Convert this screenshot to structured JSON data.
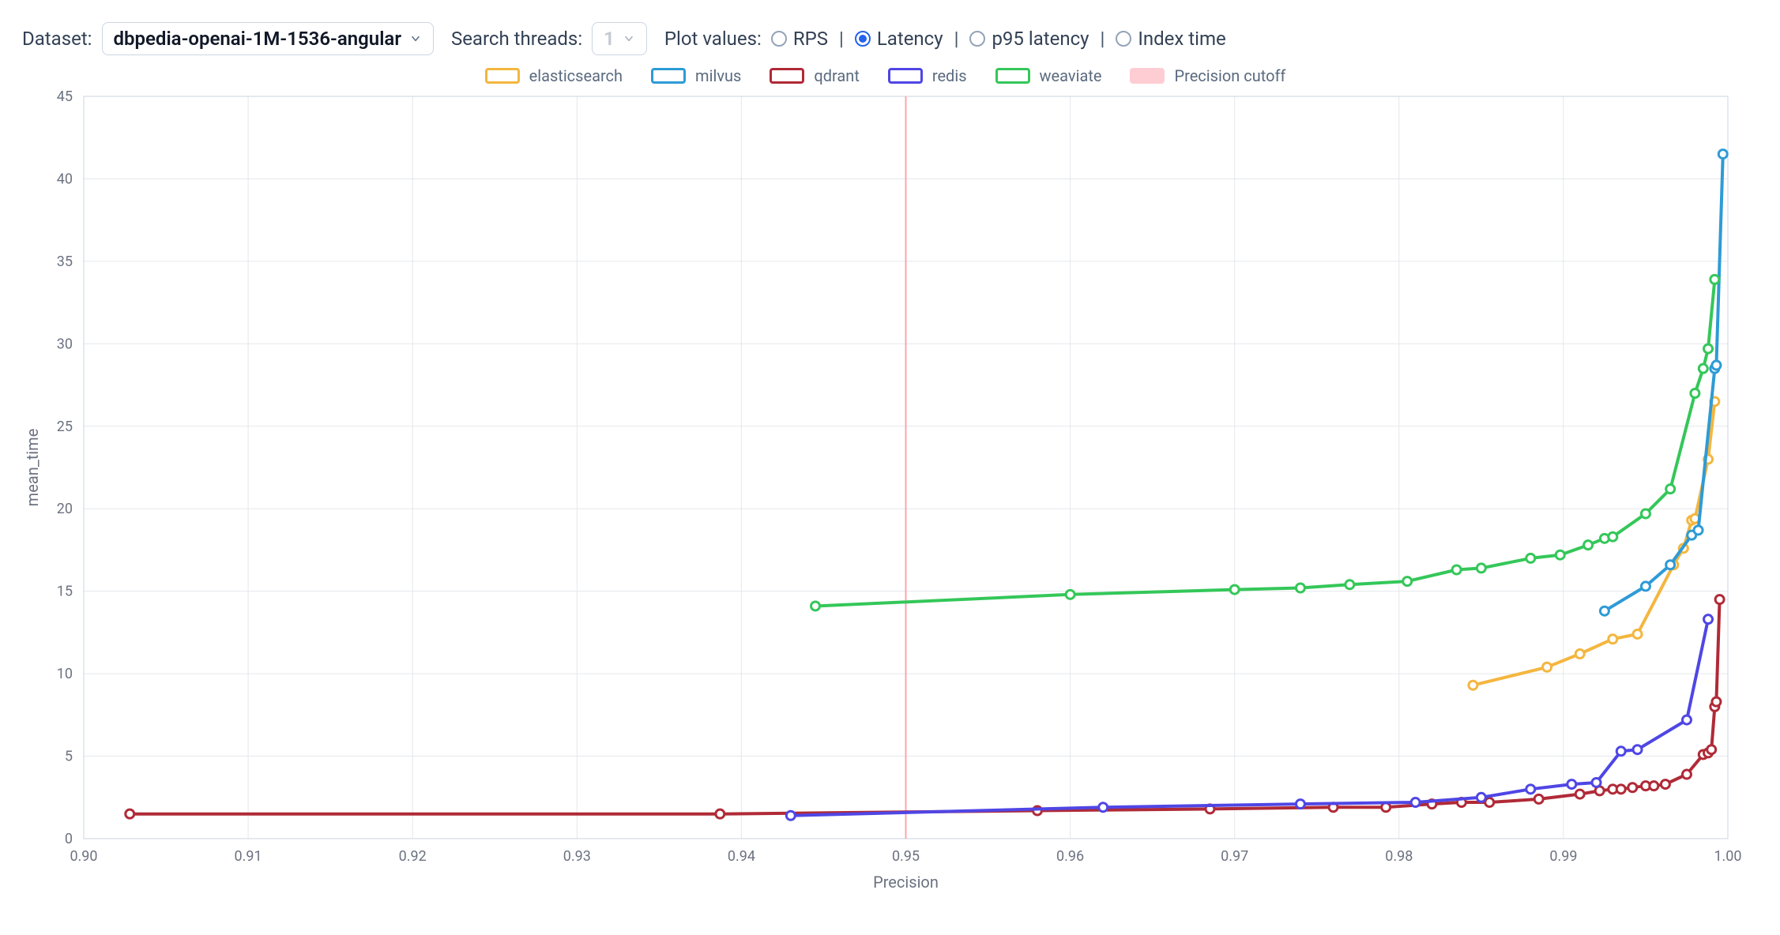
{
  "controls": {
    "dataset_label": "Dataset:",
    "dataset_value": "dbpedia-openai-1M-1536-angular",
    "threads_label": "Search threads:",
    "threads_value": "1",
    "plot_values_label": "Plot values:",
    "options": {
      "rps": "RPS",
      "latency": "Latency",
      "p95": "p95 latency",
      "index": "Index time"
    },
    "selected": "latency"
  },
  "legend": [
    {
      "key": "elasticsearch",
      "label": "elasticsearch",
      "color": "#f4b63f"
    },
    {
      "key": "milvus",
      "label": "milvus",
      "color": "#2e9bd6"
    },
    {
      "key": "qdrant",
      "label": "qdrant",
      "color": "#b02a37"
    },
    {
      "key": "redis",
      "label": "redis",
      "color": "#4f46e5"
    },
    {
      "key": "weaviate",
      "label": "weaviate",
      "color": "#34c759"
    },
    {
      "key": "cutoff",
      "label": "Precision cutoff",
      "color": "#fecdd3",
      "type": "area"
    }
  ],
  "chart_data": {
    "type": "line",
    "title": "",
    "xlabel": "Precision",
    "ylabel": "mean_time",
    "xlim": [
      0.9,
      1.0
    ],
    "ylim": [
      0,
      45
    ],
    "xticks": [
      0.9,
      0.91,
      0.92,
      0.93,
      0.94,
      0.95,
      0.96,
      0.97,
      0.98,
      0.99,
      1.0
    ],
    "yticks": [
      0,
      5,
      10,
      15,
      20,
      25,
      30,
      35,
      40,
      45
    ],
    "precision_cutoff": 0.95,
    "series": [
      {
        "name": "elasticsearch",
        "color": "#f4b63f",
        "points": [
          {
            "x": 0.9845,
            "y": 9.3
          },
          {
            "x": 0.989,
            "y": 10.4
          },
          {
            "x": 0.991,
            "y": 11.2
          },
          {
            "x": 0.993,
            "y": 12.1
          },
          {
            "x": 0.9945,
            "y": 12.4
          },
          {
            "x": 0.9967,
            "y": 16.6
          },
          {
            "x": 0.9973,
            "y": 17.6
          },
          {
            "x": 0.9978,
            "y": 19.3
          },
          {
            "x": 0.998,
            "y": 19.4
          },
          {
            "x": 0.9988,
            "y": 23.0
          },
          {
            "x": 0.9992,
            "y": 26.5
          }
        ]
      },
      {
        "name": "milvus",
        "color": "#2e9bd6",
        "points": [
          {
            "x": 0.9925,
            "y": 13.8
          },
          {
            "x": 0.995,
            "y": 15.3
          },
          {
            "x": 0.9965,
            "y": 16.6
          },
          {
            "x": 0.9978,
            "y": 18.4
          },
          {
            "x": 0.9982,
            "y": 18.7
          },
          {
            "x": 0.9992,
            "y": 28.5
          },
          {
            "x": 0.9993,
            "y": 28.7
          },
          {
            "x": 0.9997,
            "y": 41.5
          }
        ]
      },
      {
        "name": "qdrant",
        "color": "#b02a37",
        "points": [
          {
            "x": 0.9028,
            "y": 1.5
          },
          {
            "x": 0.9387,
            "y": 1.5
          },
          {
            "x": 0.958,
            "y": 1.7
          },
          {
            "x": 0.9685,
            "y": 1.8
          },
          {
            "x": 0.976,
            "y": 1.9
          },
          {
            "x": 0.9792,
            "y": 1.9
          },
          {
            "x": 0.982,
            "y": 2.1
          },
          {
            "x": 0.9838,
            "y": 2.2
          },
          {
            "x": 0.9855,
            "y": 2.2
          },
          {
            "x": 0.9885,
            "y": 2.4
          },
          {
            "x": 0.991,
            "y": 2.7
          },
          {
            "x": 0.9922,
            "y": 2.9
          },
          {
            "x": 0.993,
            "y": 3.0
          },
          {
            "x": 0.9935,
            "y": 3.0
          },
          {
            "x": 0.9942,
            "y": 3.1
          },
          {
            "x": 0.995,
            "y": 3.2
          },
          {
            "x": 0.9955,
            "y": 3.2
          },
          {
            "x": 0.9962,
            "y": 3.3
          },
          {
            "x": 0.9975,
            "y": 3.9
          },
          {
            "x": 0.9985,
            "y": 5.1
          },
          {
            "x": 0.9988,
            "y": 5.2
          },
          {
            "x": 0.999,
            "y": 5.4
          },
          {
            "x": 0.9992,
            "y": 8.0
          },
          {
            "x": 0.9993,
            "y": 8.3
          },
          {
            "x": 0.9995,
            "y": 14.5
          }
        ]
      },
      {
        "name": "redis",
        "color": "#4f46e5",
        "points": [
          {
            "x": 0.943,
            "y": 1.4
          },
          {
            "x": 0.962,
            "y": 1.9
          },
          {
            "x": 0.974,
            "y": 2.1
          },
          {
            "x": 0.981,
            "y": 2.2
          },
          {
            "x": 0.985,
            "y": 2.5
          },
          {
            "x": 0.988,
            "y": 3.0
          },
          {
            "x": 0.9905,
            "y": 3.3
          },
          {
            "x": 0.992,
            "y": 3.4
          },
          {
            "x": 0.9935,
            "y": 5.3
          },
          {
            "x": 0.9945,
            "y": 5.4
          },
          {
            "x": 0.9975,
            "y": 7.2
          },
          {
            "x": 0.9988,
            "y": 13.3
          }
        ]
      },
      {
        "name": "weaviate",
        "color": "#34c759",
        "points": [
          {
            "x": 0.9445,
            "y": 14.1
          },
          {
            "x": 0.96,
            "y": 14.8
          },
          {
            "x": 0.97,
            "y": 15.1
          },
          {
            "x": 0.974,
            "y": 15.2
          },
          {
            "x": 0.977,
            "y": 15.4
          },
          {
            "x": 0.9805,
            "y": 15.6
          },
          {
            "x": 0.9835,
            "y": 16.3
          },
          {
            "x": 0.985,
            "y": 16.4
          },
          {
            "x": 0.988,
            "y": 17.0
          },
          {
            "x": 0.9898,
            "y": 17.2
          },
          {
            "x": 0.9915,
            "y": 17.8
          },
          {
            "x": 0.9925,
            "y": 18.2
          },
          {
            "x": 0.993,
            "y": 18.3
          },
          {
            "x": 0.995,
            "y": 19.7
          },
          {
            "x": 0.9965,
            "y": 21.2
          },
          {
            "x": 0.998,
            "y": 27.0
          },
          {
            "x": 0.9985,
            "y": 28.5
          },
          {
            "x": 0.9988,
            "y": 29.7
          },
          {
            "x": 0.9992,
            "y": 33.9
          }
        ]
      }
    ]
  }
}
